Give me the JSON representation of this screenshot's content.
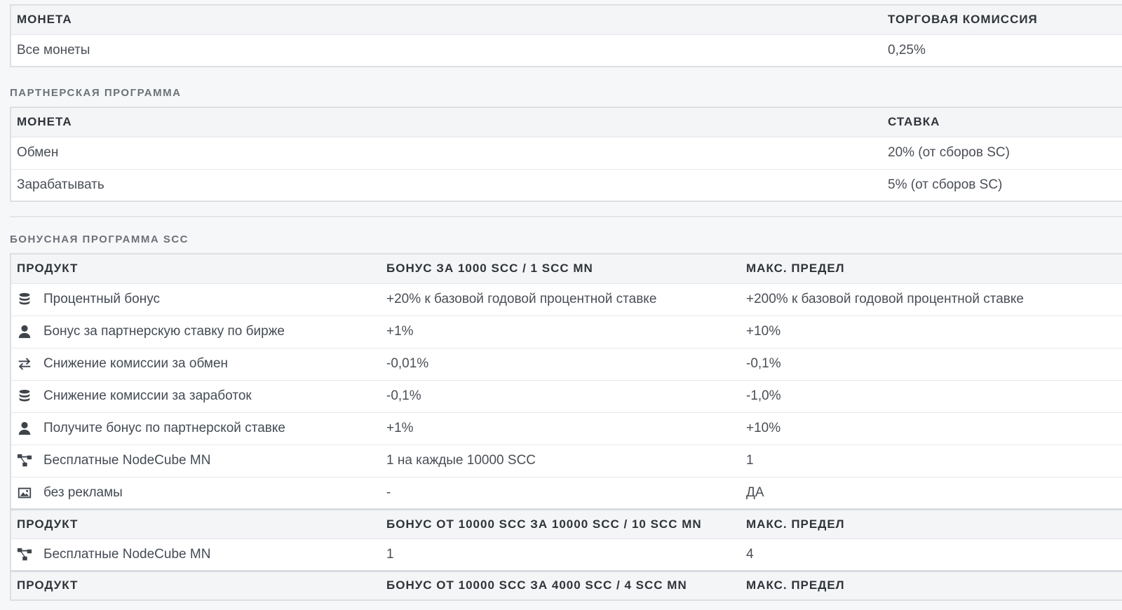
{
  "fee_table": {
    "headers": [
      "МОНЕТА",
      "ТОРГОВАЯ КОМИССИЯ"
    ],
    "rows": [
      [
        "Все монеты",
        "0,25%"
      ]
    ]
  },
  "partner": {
    "title": "ПАРТНЕРСКАЯ ПРОГРАММА",
    "headers": [
      "МОНЕТА",
      "СТАВКА"
    ],
    "rows": [
      [
        "Обмен",
        "20% (от сборов SC)"
      ],
      [
        "Зарабатывать",
        "5% (от сборов SC)"
      ]
    ]
  },
  "bonus": {
    "title": "БОНУСНАЯ ПРОГРАММА SCC",
    "header1": [
      "ПРОДУКТ",
      "БОНУС ЗА 1000 SCC / 1 SCC MN",
      "МАКС. ПРЕДЕЛ"
    ],
    "rows1": [
      {
        "icon": "coins-icon",
        "product": "Процентный бонус",
        "bonus": "+20% к базовой годовой процентной ставке",
        "max": "+200% к базовой годовой процентной ставке"
      },
      {
        "icon": "user-icon",
        "product": "Бонус за партнерскую ставку по бирже",
        "bonus": "+1%",
        "max": "+10%"
      },
      {
        "icon": "exchange-icon",
        "product": "Снижение комиссии за обмен",
        "bonus": "-0,01%",
        "max": "-0,1%"
      },
      {
        "icon": "coins-icon",
        "product": "Снижение комиссии за заработок",
        "bonus": "-0,1%",
        "max": "-1,0%"
      },
      {
        "icon": "user-icon",
        "product": "Получите бонус по партнерской ставке",
        "bonus": "+1%",
        "max": "+10%"
      },
      {
        "icon": "sitemap-icon",
        "product": "Бесплатные NodeCube MN",
        "bonus": "1 на каждые 10000 SCC",
        "max": "1"
      },
      {
        "icon": "image-icon",
        "product": "без рекламы",
        "bonus": "-",
        "max": "ДА"
      }
    ],
    "header2": [
      "ПРОДУКТ",
      "БОНУС ОТ 10000 SCC ЗА 10000 SCC / 10 SCC MN",
      "МАКС. ПРЕДЕЛ"
    ],
    "rows2": [
      {
        "icon": "sitemap-icon",
        "product": "Бесплатные NodeCube MN",
        "bonus": "1",
        "max": "4"
      }
    ],
    "header3": [
      "ПРОДУКТ",
      "БОНУС ОТ 10000 SCC ЗА 4000 SCC / 4 SCC MN",
      "МАКС. ПРЕДЕЛ"
    ]
  }
}
